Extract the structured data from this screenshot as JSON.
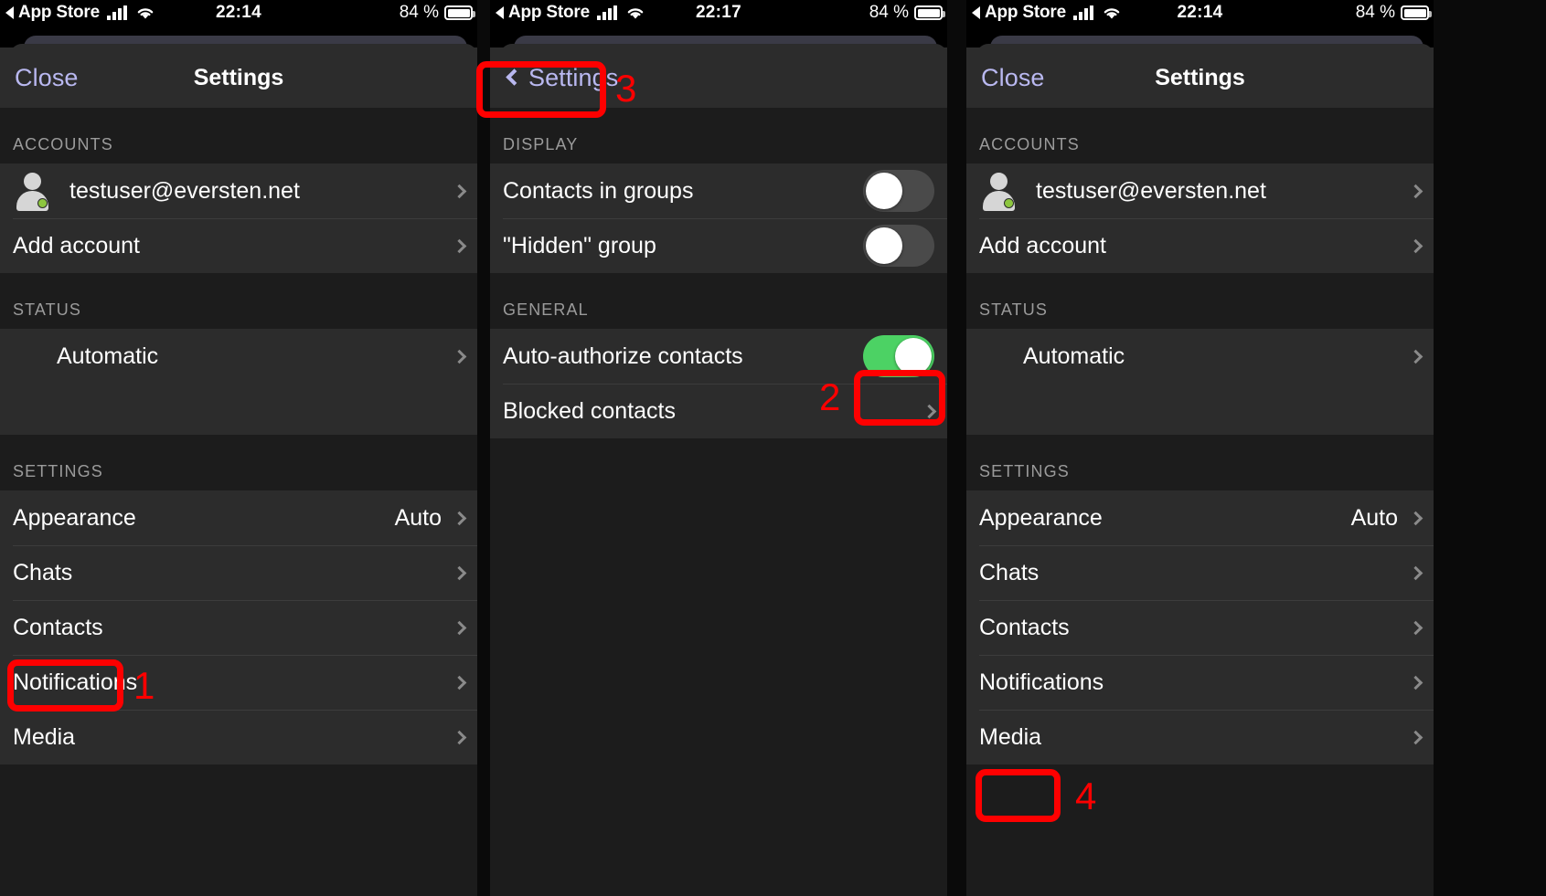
{
  "panels": [
    {
      "id": "panel-settings-root-before",
      "statusbar": {
        "back_label": "App Store",
        "time": "22:14",
        "battery_text": "84 %",
        "signal_icon": "cellular-bars-icon",
        "wifi_icon": "wifi-icon",
        "battery_icon": "battery-icon"
      },
      "nav": {
        "close_label": "Close",
        "title": "Settings"
      },
      "sections": [
        {
          "header": "ACCOUNTS",
          "rows": [
            {
              "label": "testuser@eversten.net",
              "type": "account",
              "chevron": true
            },
            {
              "label": "Add account",
              "type": "nav",
              "chevron": true
            }
          ]
        },
        {
          "header": "STATUS",
          "rows": [
            {
              "label": "Automatic",
              "type": "nav-indent",
              "chevron": true
            },
            {
              "label": "",
              "type": "blank",
              "chevron": false
            }
          ]
        },
        {
          "header": "SETTINGS",
          "rows": [
            {
              "label": "Appearance",
              "type": "nav",
              "value": "Auto",
              "chevron": true
            },
            {
              "label": "Chats",
              "type": "nav",
              "chevron": true
            },
            {
              "label": "Contacts",
              "type": "nav",
              "chevron": true
            },
            {
              "label": "Notifications",
              "type": "nav",
              "chevron": true
            },
            {
              "label": "Media",
              "type": "nav",
              "chevron": true
            }
          ]
        }
      ]
    },
    {
      "id": "panel-contacts-settings",
      "statusbar": {
        "back_label": "App Store",
        "time": "22:17",
        "battery_text": "84 %",
        "signal_icon": "cellular-bars-icon",
        "wifi_icon": "wifi-icon",
        "battery_icon": "battery-icon"
      },
      "nav": {
        "back_label": "Settings",
        "back_icon": "chevron-left-icon"
      },
      "sections": [
        {
          "header": "DISPLAY",
          "rows": [
            {
              "label": "Contacts in groups",
              "type": "switch",
              "on": false
            },
            {
              "label": "\"Hidden\" group",
              "type": "switch",
              "on": false
            }
          ]
        },
        {
          "header": "GENERAL",
          "rows": [
            {
              "label": "Auto-authorize contacts",
              "type": "switch",
              "on": true
            },
            {
              "label": "Blocked contacts",
              "type": "nav",
              "chevron": true
            }
          ]
        }
      ]
    },
    {
      "id": "panel-settings-root-after",
      "statusbar": {
        "back_label": "App Store",
        "time": "22:14",
        "battery_text": "84 %",
        "signal_icon": "cellular-bars-icon",
        "wifi_icon": "wifi-icon",
        "battery_icon": "battery-icon"
      },
      "nav": {
        "close_label": "Close",
        "title": "Settings"
      },
      "sections": [
        {
          "header": "ACCOUNTS",
          "rows": [
            {
              "label": "testuser@eversten.net",
              "type": "account",
              "chevron": true
            },
            {
              "label": "Add account",
              "type": "nav",
              "chevron": true
            }
          ]
        },
        {
          "header": "STATUS",
          "rows": [
            {
              "label": "Automatic",
              "type": "nav-indent",
              "chevron": true
            },
            {
              "label": "",
              "type": "blank",
              "chevron": false
            }
          ]
        },
        {
          "header": "SETTINGS",
          "rows": [
            {
              "label": "Appearance",
              "type": "nav",
              "value": "Auto",
              "chevron": true
            },
            {
              "label": "Chats",
              "type": "nav",
              "chevron": true
            },
            {
              "label": "Contacts",
              "type": "nav",
              "chevron": true
            },
            {
              "label": "Notifications",
              "type": "nav",
              "chevron": true
            },
            {
              "label": "Media",
              "type": "nav",
              "chevron": true
            }
          ]
        }
      ]
    }
  ],
  "annotations": {
    "step1": "1",
    "step2": "2",
    "step3": "3",
    "step4": "4",
    "highlight_color": "#fe0000"
  },
  "colors": {
    "accent_link": "#b9b8f0",
    "switch_on": "#4cd264",
    "switch_off": "#4a4a4a",
    "row_bg": "#2c2c2c",
    "page_bg": "#1c1c1c",
    "presence_online": "#8dc63f"
  }
}
